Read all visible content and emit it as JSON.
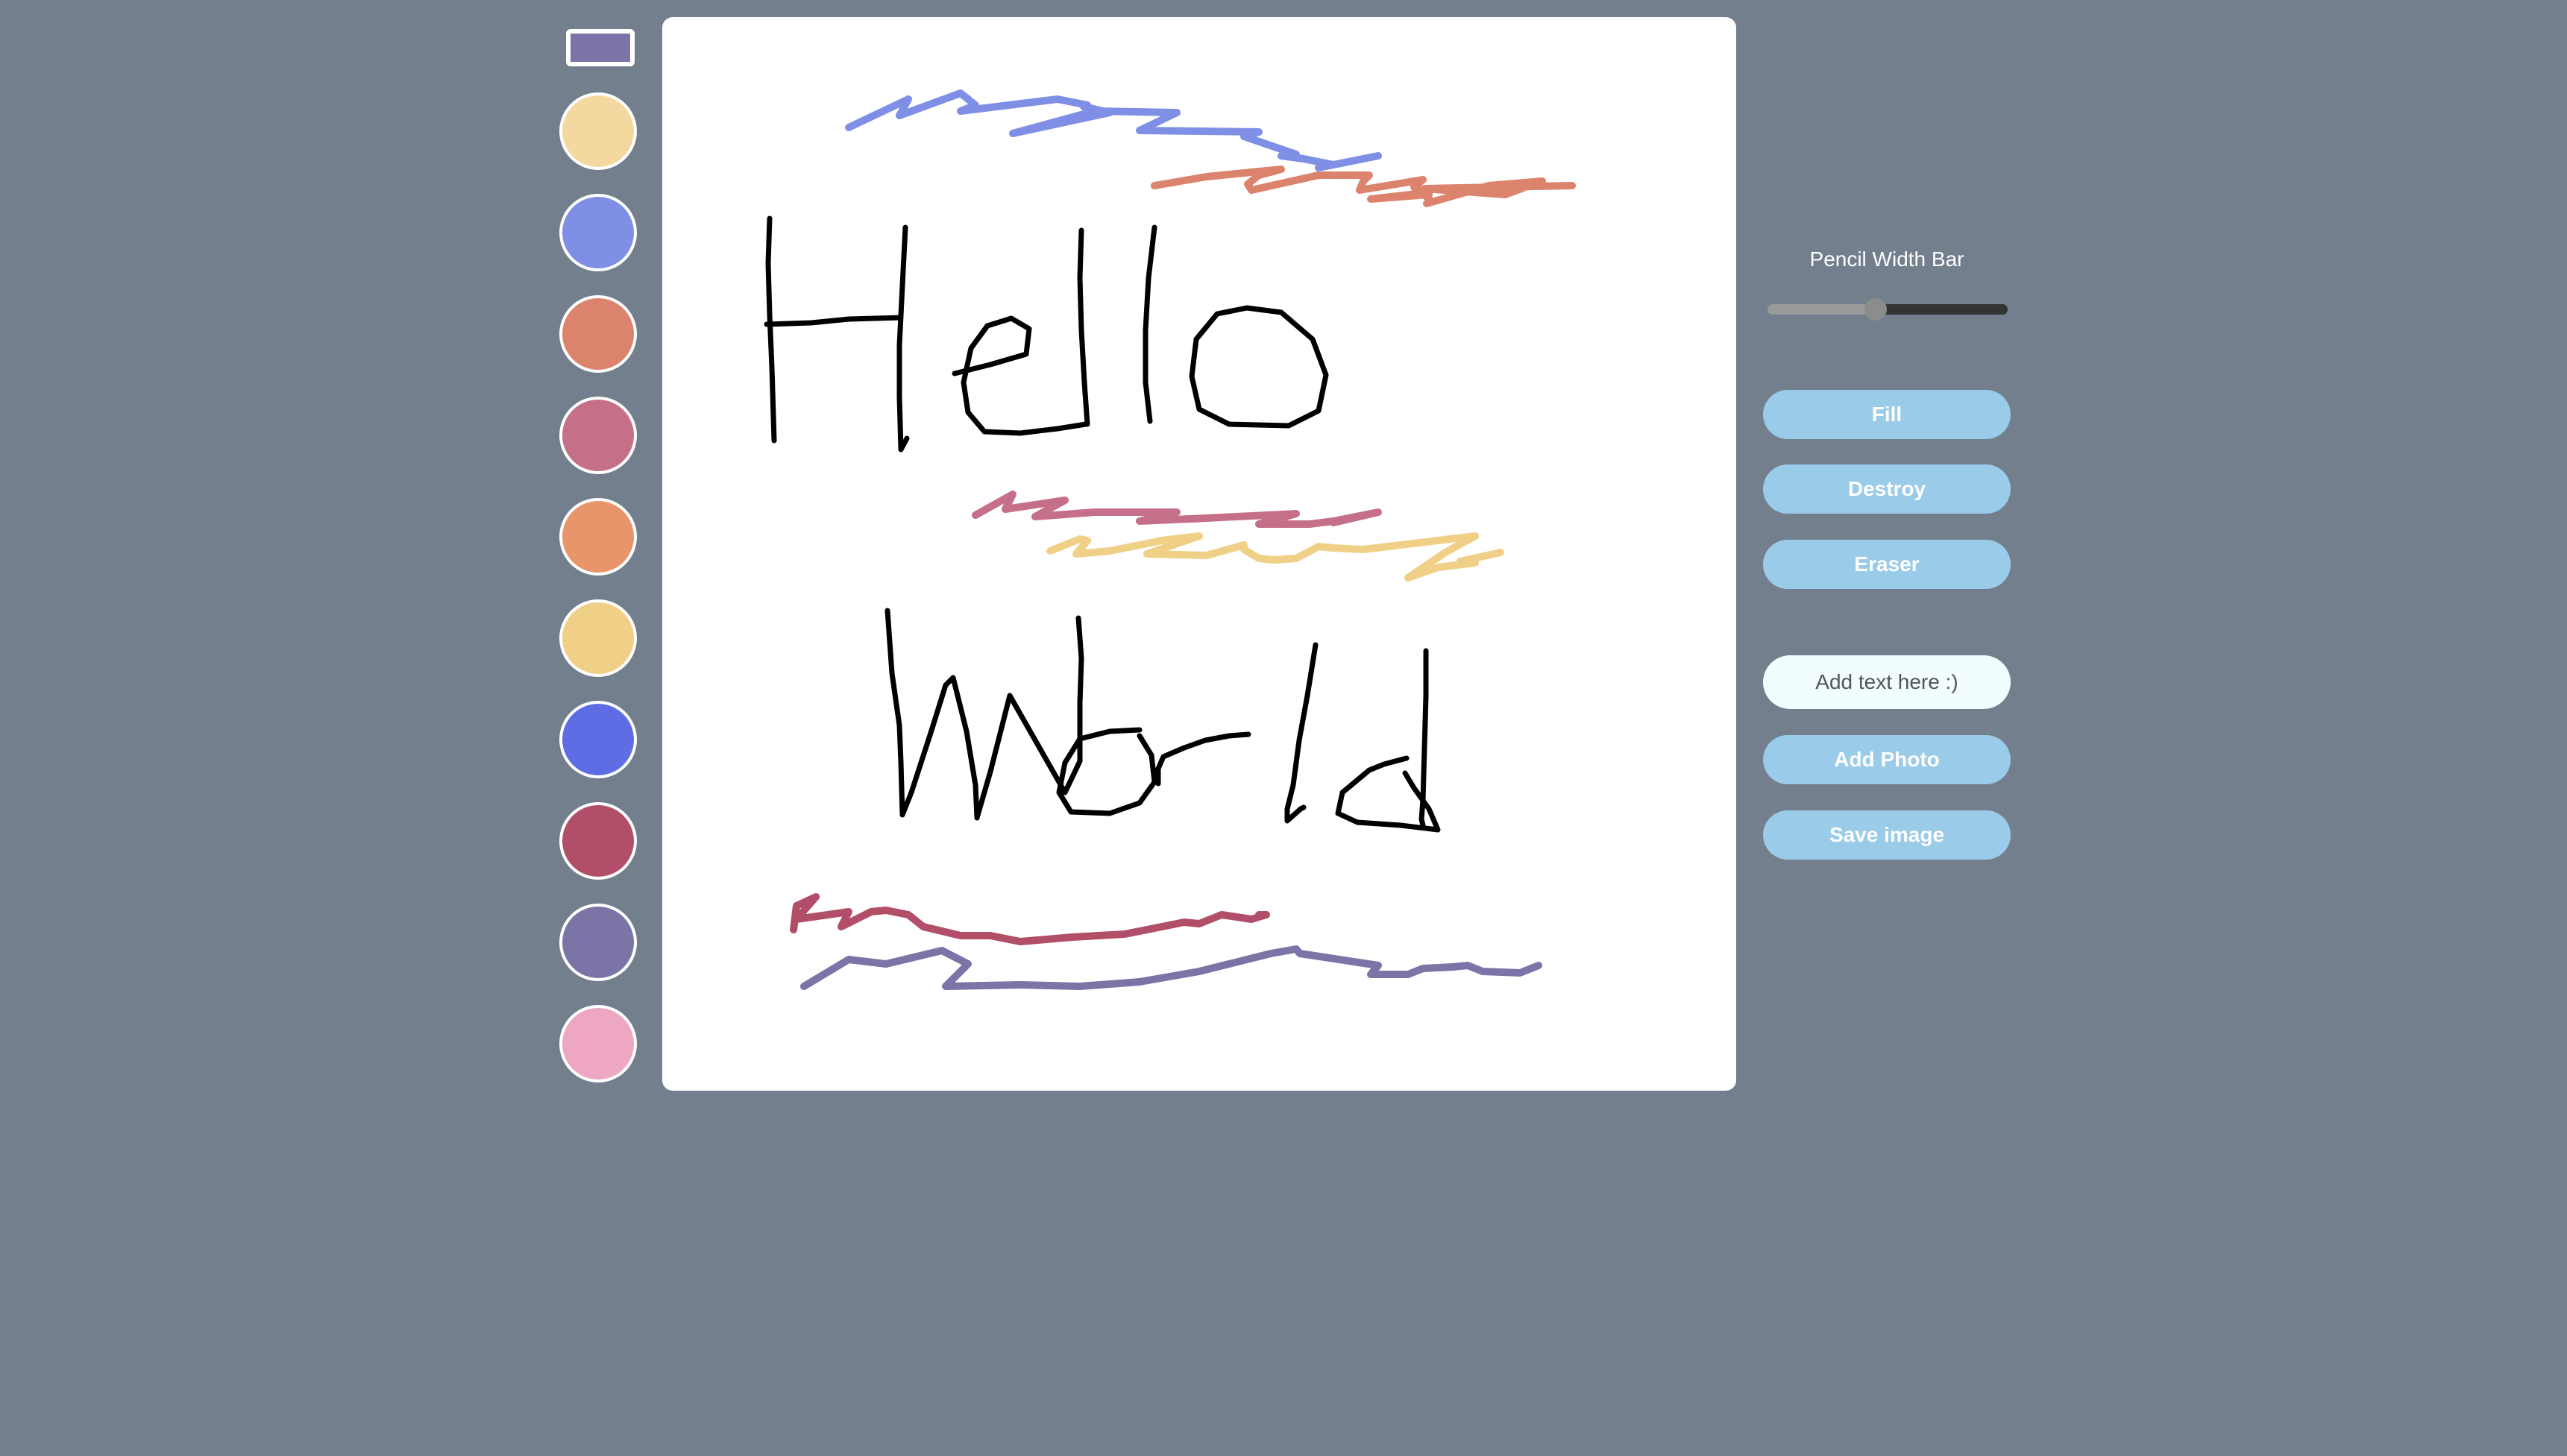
{
  "palette": {
    "current_color": "#7a75a6",
    "colors": [
      {
        "name": "pale-yellow",
        "hex": "#f3d99f"
      },
      {
        "name": "periwinkle",
        "hex": "#7e8fe5"
      },
      {
        "name": "terracotta",
        "hex": "#db836c"
      },
      {
        "name": "rose",
        "hex": "#c66f88"
      },
      {
        "name": "orange",
        "hex": "#e9956c"
      },
      {
        "name": "mustard",
        "hex": "#f0d087"
      },
      {
        "name": "royal-blue",
        "hex": "#5e6de3"
      },
      {
        "name": "crimson",
        "hex": "#b14f68"
      },
      {
        "name": "lavender",
        "hex": "#7a75a6"
      },
      {
        "name": "pink",
        "hex": "#eea7c3"
      }
    ]
  },
  "controls": {
    "width_label": "Pencil Width Bar",
    "width_value": 0.45,
    "fill_label": "Fill",
    "destroy_label": "Destroy",
    "eraser_label": "Eraser",
    "text_placeholder": "Add text here :)",
    "add_photo_label": "Add Photo",
    "save_label": "Save image"
  },
  "canvas": {
    "background": "#ffffff",
    "ink_color": "#000000"
  }
}
